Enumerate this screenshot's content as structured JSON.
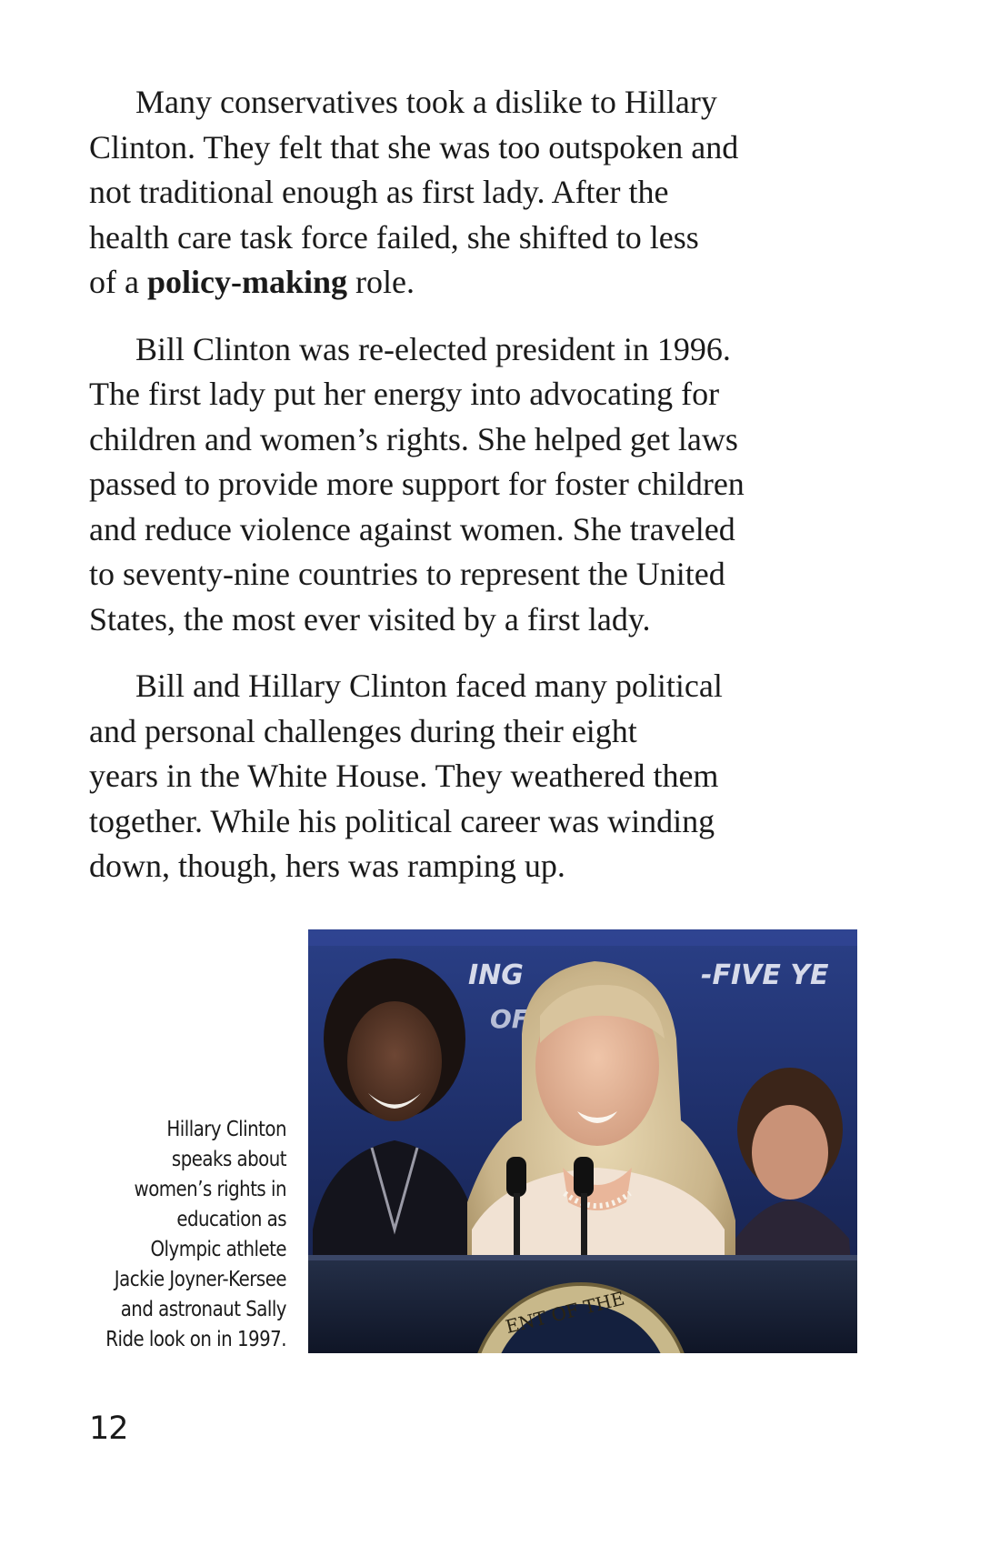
{
  "paragraphs": [
    {
      "lines": [
        "Many conservatives took a dislike to Hillary",
        "Clinton. They felt that she was too outspoken and",
        "not traditional enough as first lady. After the",
        "health care task force failed, she shifted to less"
      ],
      "last_line": {
        "before": "of a ",
        "term": "policy-making",
        "after": " role."
      }
    },
    {
      "lines": [
        "Bill Clinton was re-elected president in 1996.",
        "The first lady put her energy into advocating for",
        "children and women’s rights. She helped get laws",
        "passed to provide more support for foster children",
        "and reduce violence against women. She traveled",
        "to seventy-nine countries to represent the United",
        "States, the most ever visited by a first lady."
      ]
    },
    {
      "lines": [
        "Bill and Hillary Clinton faced many political",
        "and personal challenges during their eight",
        "years in the White House. They weathered them",
        "together. While his political career was winding",
        "down, though, hers was ramping up."
      ]
    }
  ],
  "photo": {
    "banner_text": "ING",
    "banner_text_2": "-FIVE YE",
    "banner_text_3": "OF",
    "seal_text": "ENT OF THE"
  },
  "caption": {
    "lines": [
      "Hillary Clinton",
      "speaks about",
      "women’s rights in",
      "education as",
      "Olympic athlete",
      "Jackie Joyner-Kersee",
      "and astronaut Sally",
      "Ride look on in 1997."
    ]
  },
  "page_number": "12"
}
